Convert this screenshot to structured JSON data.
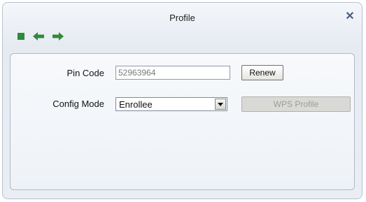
{
  "window": {
    "title": "Profile"
  },
  "toolbar": {
    "stop_icon": "stop-icon",
    "back_icon": "arrow-left-icon",
    "forward_icon": "arrow-right-icon",
    "icon_color": "#2f8a3a"
  },
  "form": {
    "pin_code_label": "Pin Code",
    "pin_code_value": "52963964",
    "renew_label": "Renew",
    "config_mode_label": "Config Mode",
    "config_mode_value": "Enrollee",
    "wps_profile_label": "WPS Profile"
  }
}
